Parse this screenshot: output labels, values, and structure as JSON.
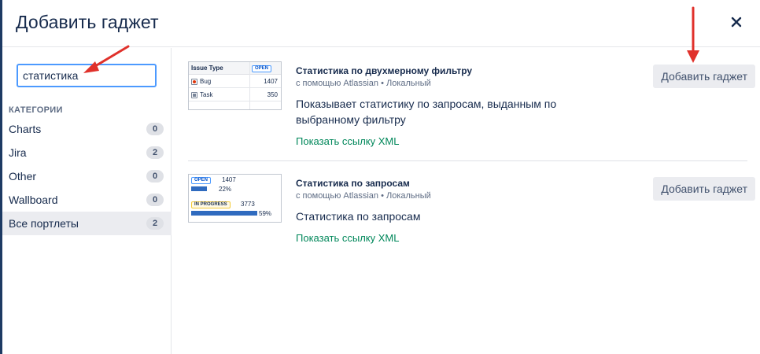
{
  "dialog": {
    "title": "Добавить гаджет",
    "close_icon": "close-icon"
  },
  "sidebar": {
    "search": {
      "value": "статистика",
      "placeholder": ""
    },
    "categories_heading": "КАТЕГОРИИ",
    "categories": [
      {
        "label": "Charts",
        "count": "0",
        "selected": false
      },
      {
        "label": "Jira",
        "count": "2",
        "selected": false
      },
      {
        "label": "Other",
        "count": "0",
        "selected": false
      },
      {
        "label": "Wallboard",
        "count": "0",
        "selected": false
      },
      {
        "label": "Все портлеты",
        "count": "2",
        "selected": true
      }
    ]
  },
  "gadgets": [
    {
      "name": "Статистика по двухмерному фильтру",
      "meta": "с помощью Atlassian • Локальный",
      "description": "Показывает статистику по запросам, выданным по выбранному фильтру",
      "xml_link": "Показать ссылку XML",
      "add_label": "Добавить гаджет",
      "thumbnail": {
        "header_title": "Issue Type",
        "header_status": "OPEN",
        "rows": [
          {
            "icon": "bug-icon",
            "label": "Bug",
            "value": "1407"
          },
          {
            "icon": "task-icon",
            "label": "Task",
            "value": "350"
          }
        ]
      }
    },
    {
      "name": "Статистика по запросам",
      "meta": "с помощью Atlassian • Локальный",
      "description": "Статистика по запросам",
      "xml_link": "Показать ссылку XML",
      "add_label": "Добавить гаджет",
      "thumbnail": {
        "status1": "OPEN",
        "count1": "1407",
        "pct1": "22%",
        "fill1": 0.22,
        "status2": "IN PROGRESS",
        "count2": "3773",
        "pct2": "59%",
        "fill2": 0.59
      }
    }
  ],
  "colors": {
    "accent": "#4c9aff",
    "link": "#00875a",
    "annotation_arrow": "#e0312b",
    "bar": "#2f6bbf"
  }
}
